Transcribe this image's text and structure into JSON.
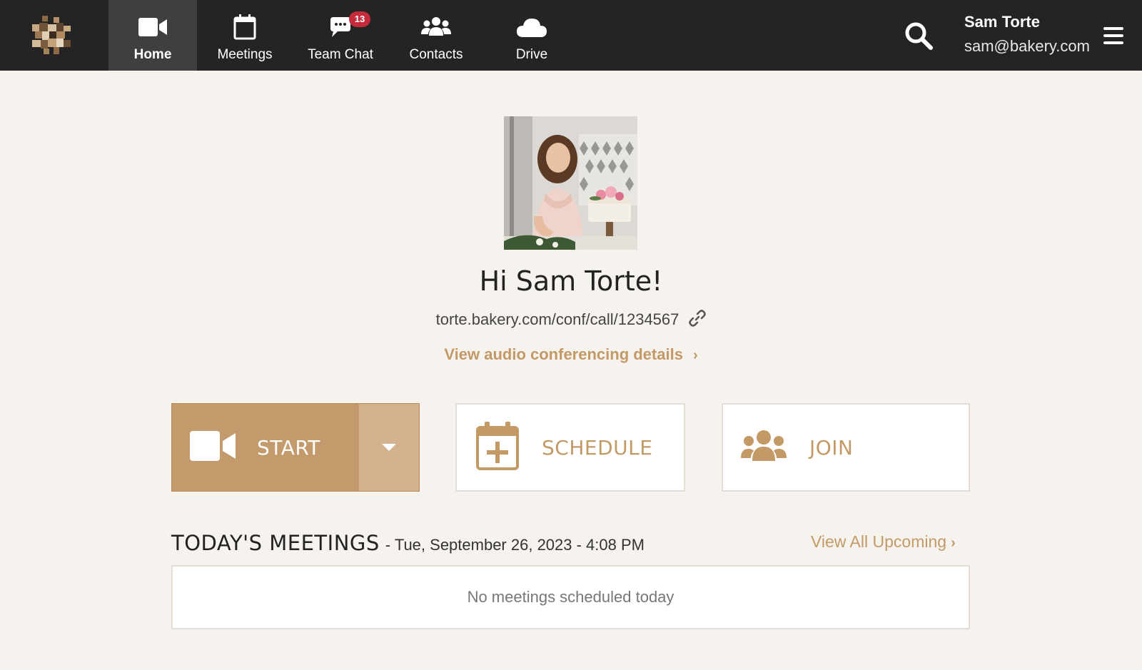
{
  "nav": {
    "items": [
      {
        "label": "Home",
        "icon": "video-camera-icon",
        "active": true
      },
      {
        "label": "Meetings",
        "icon": "calendar-icon"
      },
      {
        "label": "Team Chat",
        "icon": "chat-bubble-icon",
        "badge": "13"
      },
      {
        "label": "Contacts",
        "icon": "users-icon"
      },
      {
        "label": "Drive",
        "icon": "cloud-icon"
      }
    ]
  },
  "user": {
    "name": "Sam Torte",
    "email": "sam@bakery.com"
  },
  "profile": {
    "greeting": "Hi Sam Torte!",
    "conference_link": "torte.bakery.com/conf/call/1234567",
    "audio_details_label": "View audio conferencing details"
  },
  "actions": {
    "start_label": "START",
    "schedule_label": "SCHEDULE",
    "join_label": "JOIN"
  },
  "meetings": {
    "title": "TODAY'S MEETINGS",
    "date_text": "- Tue, September 26, 2023 - 4:08 PM",
    "view_all_label": "View All Upcoming",
    "empty_text": "No meetings scheduled today"
  },
  "colors": {
    "accent": "#c39966",
    "topbar": "#242424",
    "badge": "#c62b3c",
    "background": "#f6f3ef"
  }
}
